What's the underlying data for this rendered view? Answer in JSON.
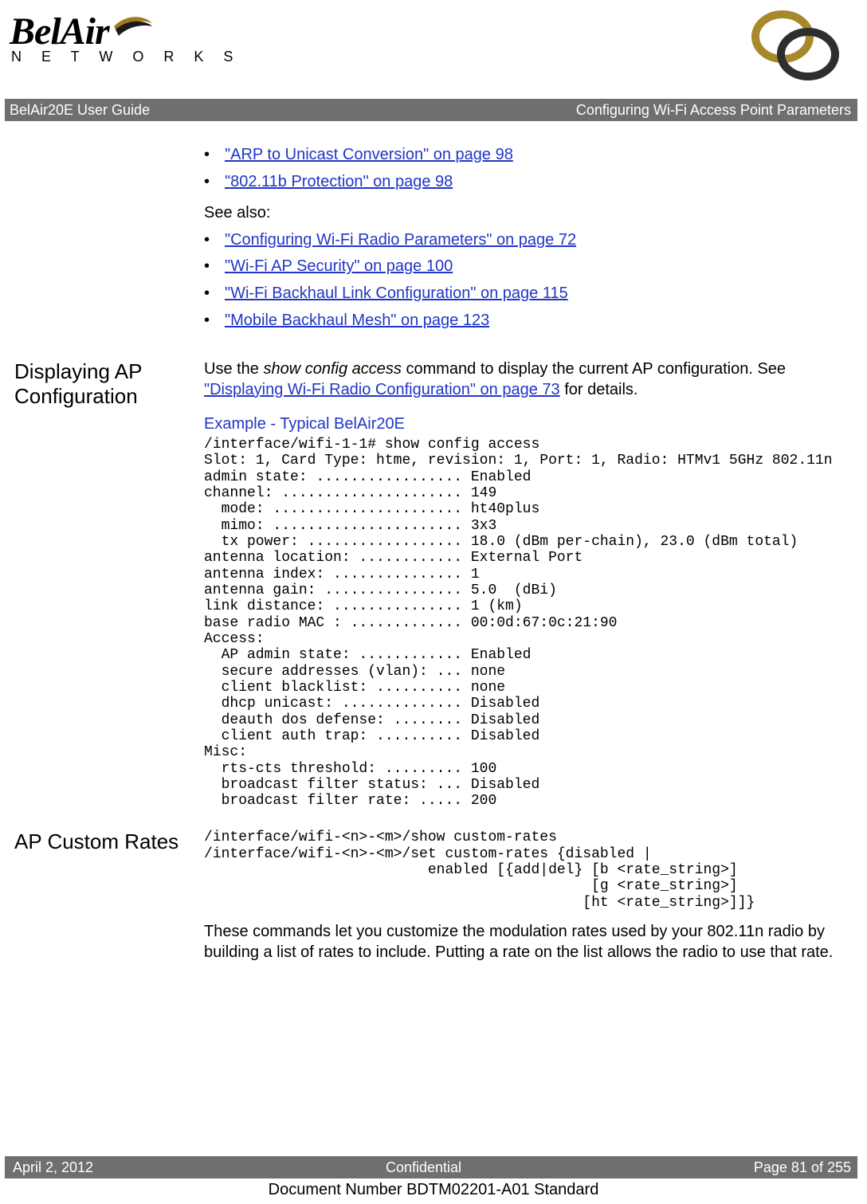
{
  "logo": {
    "word1": "BelAir",
    "word2": "N E T W O R K S"
  },
  "breadcrumb": {
    "left": "BelAir20E User Guide",
    "right": "Configuring Wi-Fi Access Point Parameters"
  },
  "top_links": [
    "\"ARP to Unicast Conversion\" on page 98",
    "\"802.11b Protection\" on page 98"
  ],
  "see_also_label": "See also:",
  "see_also_links": [
    "\"Configuring Wi-Fi Radio Parameters\" on page 72",
    "\"Wi-Fi AP Security\" on page 100",
    "\"Wi-Fi Backhaul Link Configuration\" on page 115",
    "\"Mobile Backhaul Mesh\" on page 123"
  ],
  "section1": {
    "heading": "Displaying AP Configuration",
    "p1a": "Use the ",
    "p1b": "show config access",
    "p1c": " command to display the current AP configuration. See ",
    "p1d": "\"Displaying Wi-Fi Radio Configuration\" on page 73",
    "p1e": " for details.",
    "example_head": "Example - Typical BelAir20E",
    "example_body": "/interface/wifi-1-1# show config access\nSlot: 1, Card Type: htme, revision: 1, Port: 1, Radio: HTMv1 5GHz 802.11n\nadmin state: ................. Enabled\nchannel: ..................... 149\n  mode: ...................... ht40plus\n  mimo: ...................... 3x3\n  tx power: .................. 18.0 (dBm per-chain), 23.0 (dBm total)\nantenna location: ............ External Port\nantenna index: ............... 1\nantenna gain: ................ 5.0  (dBi)\nlink distance: ............... 1 (km)\nbase radio MAC : ............. 00:0d:67:0c:21:90\nAccess:\n  AP admin state: ............ Enabled\n  secure addresses (vlan): ... none\n  client blacklist: .......... none\n  dhcp unicast: .............. Disabled\n  deauth dos defense: ........ Disabled\n  client auth trap: .......... Disabled\nMisc:\n  rts-cts threshold: ......... 100\n  broadcast filter status: ... Disabled\n  broadcast filter rate: ..... 200"
  },
  "section2": {
    "heading": "AP Custom Rates",
    "cmd": "/interface/wifi-<n>-<m>/show custom-rates\n/interface/wifi-<n>-<m>/set custom-rates {disabled |\n                          enabled [{add|del} [b <rate_string>]\n                                             [g <rate_string>]\n                                            [ht <rate_string>]]}",
    "para": "These commands let you customize the modulation rates used by your 802.11n radio by building a list of rates to include. Putting a rate on the list allows the radio to use that rate."
  },
  "footer": {
    "left": "April 2, 2012",
    "center": "Confidential",
    "right": "Page 81 of 255"
  },
  "docnum": "Document Number BDTM02201-A01 Standard"
}
